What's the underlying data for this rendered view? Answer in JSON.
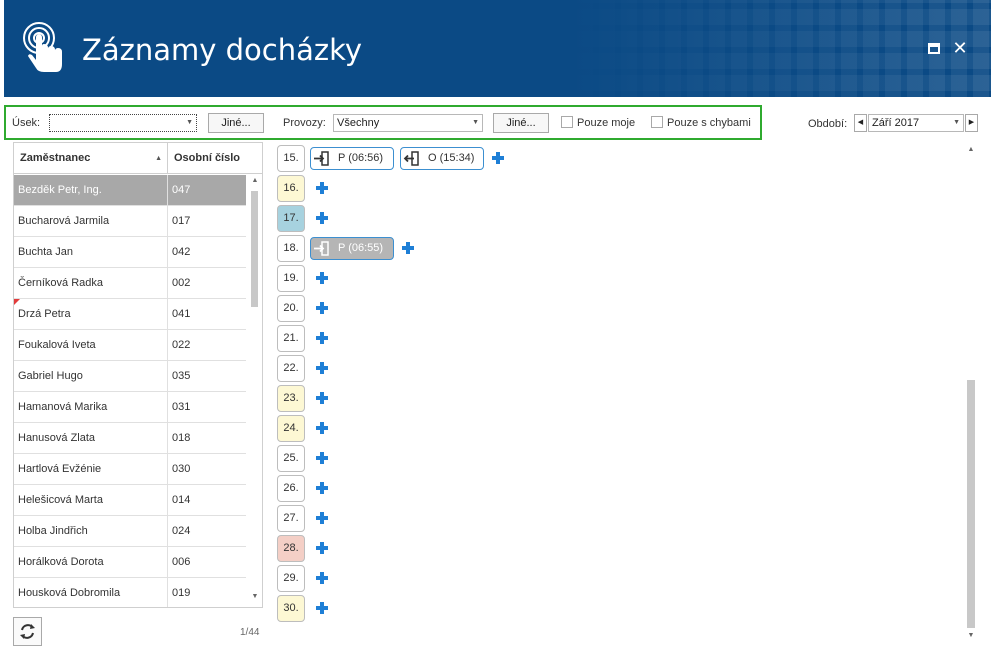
{
  "window": {
    "title": "Záznamy docházky",
    "maximize_icon": "maximize-icon",
    "close_glyph": "✕"
  },
  "filters": {
    "usek_label": "Úsek:",
    "usek_value": "",
    "jine1_label": "Jiné...",
    "provozy_label": "Provozy:",
    "provozy_value": "Všechny",
    "jine2_label": "Jiné...",
    "pouze_moje_label": "Pouze moje",
    "pouze_moje_checked": false,
    "pouze_chyby_label": "Pouze s chybami",
    "pouze_chyby_checked": false
  },
  "period": {
    "label": "Období:",
    "value": "Září 2017"
  },
  "table": {
    "columns": [
      "Zaměstnanec",
      "Osobní číslo"
    ],
    "rows": [
      {
        "name": "Bezděk Petr, Ing.",
        "num": "047",
        "selected": true
      },
      {
        "name": "Bucharová Jarmila",
        "num": "017"
      },
      {
        "name": "Buchta Jan",
        "num": "042"
      },
      {
        "name": "Černíková Radka",
        "num": "002"
      },
      {
        "name": "Drzá Petra",
        "num": "041",
        "flag": true
      },
      {
        "name": "Foukalová Iveta",
        "num": "022"
      },
      {
        "name": "Gabriel Hugo",
        "num": "035"
      },
      {
        "name": "Hamanová Marika",
        "num": "031"
      },
      {
        "name": "Hanusová Zlata",
        "num": "018"
      },
      {
        "name": "Hartlová Evžénie",
        "num": "030"
      },
      {
        "name": "Helešicová Marta",
        "num": "014"
      },
      {
        "name": "Holba Jindřich",
        "num": "024"
      },
      {
        "name": "Horálková Dorota",
        "num": "006"
      },
      {
        "name": "Housková Dobromila",
        "num": "019"
      }
    ],
    "pager": "1/44"
  },
  "calendar": {
    "days": [
      {
        "label": "15.",
        "style": "normal",
        "records": [
          {
            "type": "arrival",
            "text": "P (06:56)",
            "style": "outline"
          },
          {
            "type": "departure",
            "text": "O (15:34)",
            "style": "outline"
          }
        ]
      },
      {
        "label": "16.",
        "style": "sat",
        "records": []
      },
      {
        "label": "17.",
        "style": "blue",
        "records": []
      },
      {
        "label": "18.",
        "style": "normal",
        "records": [
          {
            "type": "arrival",
            "text": "P (06:55)",
            "style": "grey"
          }
        ]
      },
      {
        "label": "19.",
        "style": "normal",
        "records": []
      },
      {
        "label": "20.",
        "style": "normal",
        "records": []
      },
      {
        "label": "21.",
        "style": "normal",
        "records": []
      },
      {
        "label": "22.",
        "style": "normal",
        "records": []
      },
      {
        "label": "23.",
        "style": "sat",
        "records": []
      },
      {
        "label": "24.",
        "style": "sat",
        "records": []
      },
      {
        "label": "25.",
        "style": "normal",
        "records": []
      },
      {
        "label": "26.",
        "style": "normal",
        "records": []
      },
      {
        "label": "27.",
        "style": "normal",
        "records": []
      },
      {
        "label": "28.",
        "style": "red",
        "records": []
      },
      {
        "label": "29.",
        "style": "normal",
        "records": []
      },
      {
        "label": "30.",
        "style": "sat",
        "records": []
      }
    ]
  },
  "colors": {
    "header_bg": "#0b4a85",
    "filter_border": "#2faa2f",
    "accent_blue": "#1e7fd6",
    "selected_row": "#a8a8a8"
  }
}
